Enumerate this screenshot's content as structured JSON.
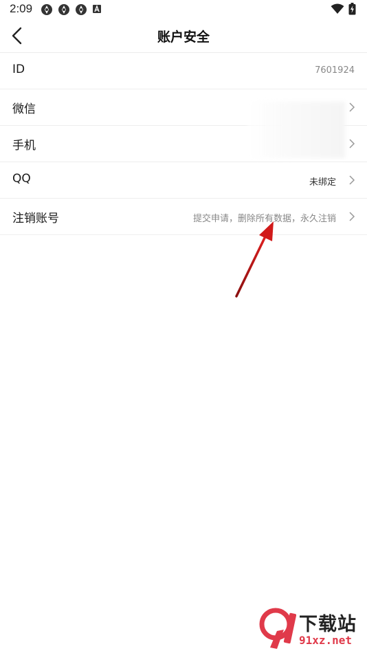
{
  "status_bar": {
    "time": "2:09",
    "left_icons": [
      "notification-icon",
      "notification-icon",
      "notification-icon",
      "a-badge-icon"
    ],
    "right_icons": [
      "wifi-icon",
      "battery-icon"
    ]
  },
  "header": {
    "title": "账户安全",
    "back_icon": "chevron-left-icon"
  },
  "rows": [
    {
      "label": "ID",
      "value": "7601924",
      "has_arrow": false
    },
    {
      "label": "微信",
      "value": "",
      "has_arrow": true
    },
    {
      "label": "手机",
      "value": "",
      "has_arrow": true
    },
    {
      "label": "QQ",
      "value": "未绑定",
      "has_arrow": true
    },
    {
      "label": "注销账号",
      "value": "提交申请，删除所有数据，永久注销",
      "has_arrow": true
    }
  ],
  "annotation": {
    "arrow_color": "#d11a1a"
  },
  "watermark": {
    "title": "下载站",
    "url": "91xz.net",
    "accent": "#e03a4a"
  }
}
